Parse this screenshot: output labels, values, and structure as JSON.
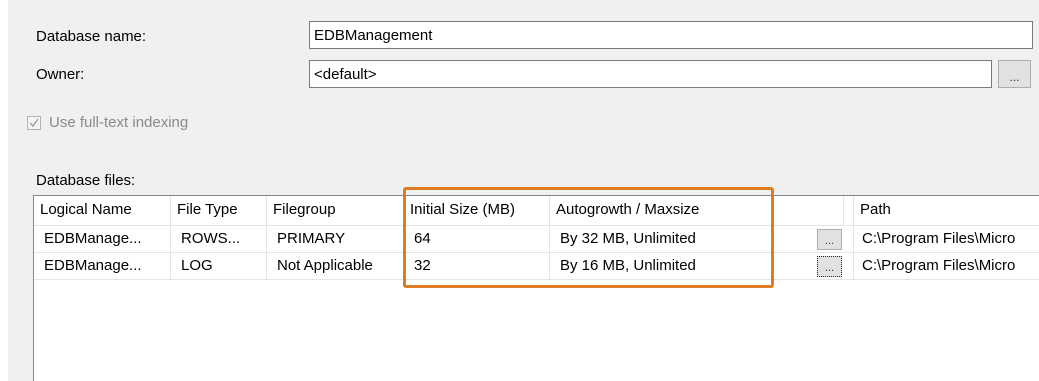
{
  "form": {
    "database_name_label": "Database name:",
    "database_name_value": "EDBManagement",
    "owner_label": "Owner:",
    "owner_value": "<default>",
    "owner_browse_label": "...",
    "fulltext_label": "Use full-text indexing",
    "fulltext_checked": true
  },
  "files": {
    "section_label": "Database files:",
    "columns": [
      "Logical Name",
      "File Type",
      "Filegroup",
      "Initial Size (MB)",
      "Autogrowth / Maxsize",
      "",
      "Path"
    ],
    "browse_label": "...",
    "rows": [
      {
        "logical_name": "EDBManage...",
        "file_type": "ROWS...",
        "filegroup": "PRIMARY",
        "initial_size": "64",
        "autogrowth": "By 32 MB, Unlimited",
        "path": "C:\\Program Files\\Micro"
      },
      {
        "logical_name": "EDBManage...",
        "file_type": "LOG",
        "filegroup": "Not Applicable",
        "initial_size": "32",
        "autogrowth": "By 16 MB, Unlimited",
        "path": "C:\\Program Files\\Micro"
      }
    ]
  },
  "colors": {
    "highlight": "#e07b25",
    "panel_bg": "#f0f0f0"
  }
}
